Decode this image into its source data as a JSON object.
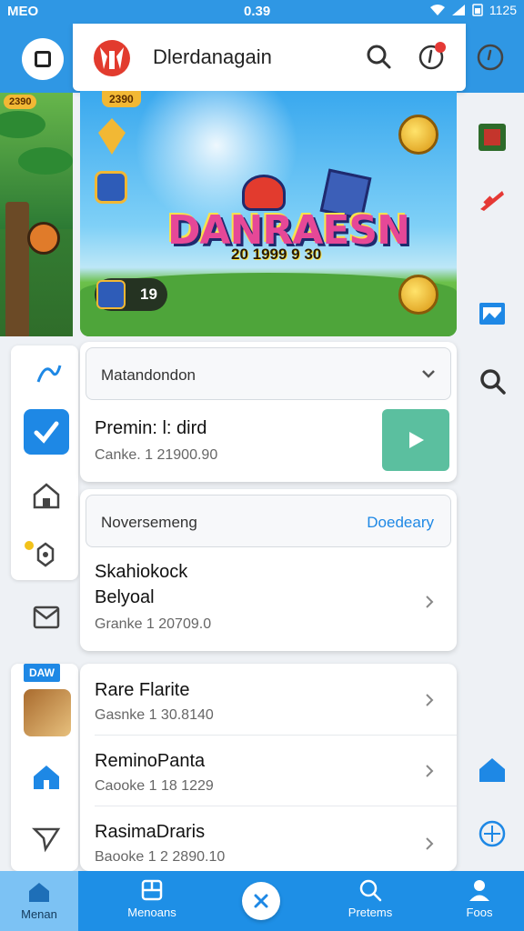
{
  "status_bar": {
    "left": "MEO",
    "center": "0.39",
    "right": "1125"
  },
  "header": {
    "title": "Dlerdanagain",
    "logo": "red-mask-logo"
  },
  "banner": {
    "title": "DANRAESN",
    "subtitle": "20 1999 9 30",
    "badge": "2390",
    "counter": "19"
  },
  "left_rail": {
    "badge": "2390",
    "tag": "DAW"
  },
  "card_one": {
    "dropdown_label": "Matandondon",
    "item_title": "Premin: l: dird",
    "item_sub": "Canke. 1 21900.90"
  },
  "card_two": {
    "dropdown_label": "Noversemeng",
    "dropdown_action": "Doedeary",
    "item_title_line1": "Skahiokock",
    "item_title_line2": "Belyoal",
    "item_sub": "Granke 1 20709.0"
  },
  "card_three": {
    "items": [
      {
        "title": "Rare Flarite",
        "sub": "Gasnke 1 30.8140"
      },
      {
        "title": "ReminoPanta",
        "sub": "Caooke 1 18 1229"
      },
      {
        "title": "RasimaDraris",
        "sub": "Baooke 1 2 2890.10"
      }
    ]
  },
  "bottom_nav": {
    "home": "Menan",
    "menu": "Menoans",
    "search": "Pretems",
    "profile": "Foos"
  },
  "colors": {
    "primary": "#2f97e4",
    "accent": "#1e88e5",
    "play": "#5bbf9f"
  }
}
